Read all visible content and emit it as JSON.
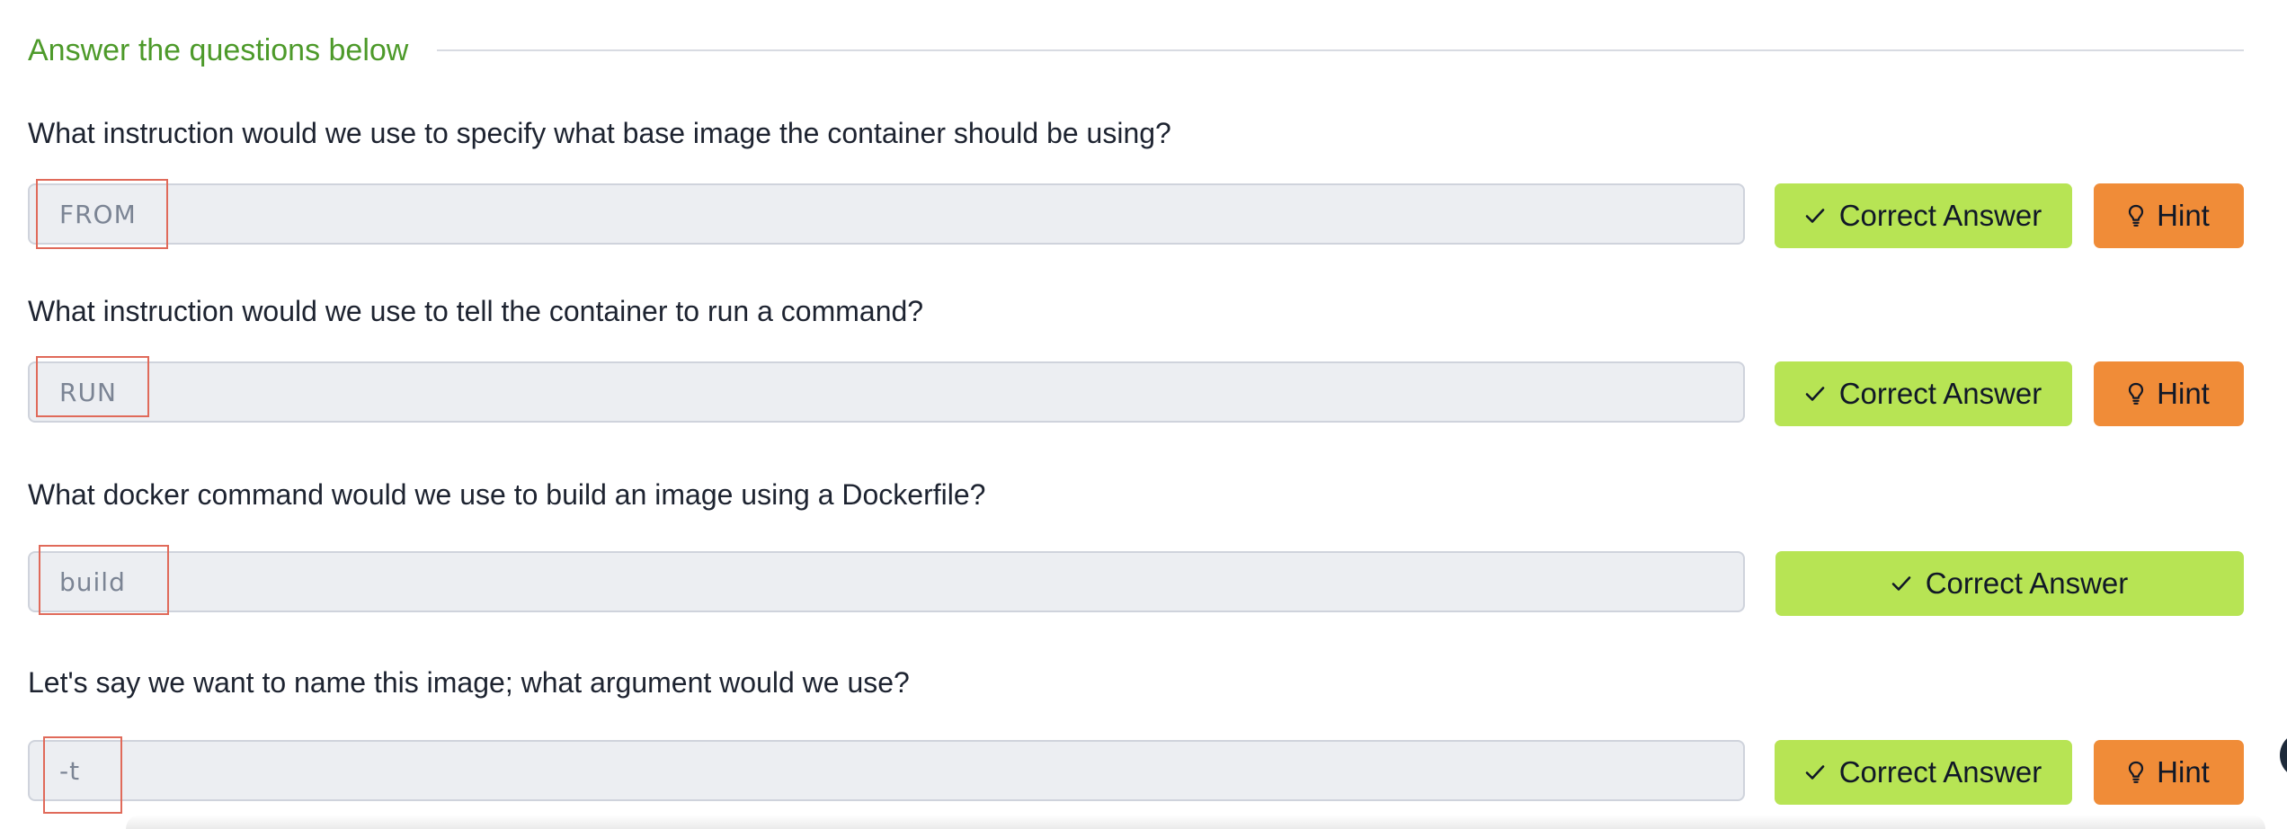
{
  "section": {
    "title": "Answer the questions below"
  },
  "questions": [
    {
      "text": "What instruction would we use to specify what base image the container should be using?",
      "answer": "FROM",
      "correct_label": "Correct Answer",
      "hint_label": "Hint",
      "has_hint": true
    },
    {
      "text": "What instruction would we use to tell the container to run a command?",
      "answer": "RUN",
      "correct_label": "Correct Answer",
      "hint_label": "Hint",
      "has_hint": true
    },
    {
      "text": "What docker command would we use to build an image using a Dockerfile?",
      "answer": "build",
      "correct_label": "Correct Answer",
      "has_hint": false
    },
    {
      "text": "Let's say we want to name this image; what argument would we use?",
      "answer": "-t",
      "correct_label": "Correct Answer",
      "hint_label": "Hint",
      "has_hint": true
    }
  ],
  "icons": {
    "correct": "check-icon",
    "hint": "lightbulb-icon"
  },
  "colors": {
    "section_title": "#4d9a2a",
    "correct_button": "#b7e454",
    "hint_button": "#f08c38",
    "input_background": "#eceef2",
    "highlight_box": "#e06a5a"
  }
}
